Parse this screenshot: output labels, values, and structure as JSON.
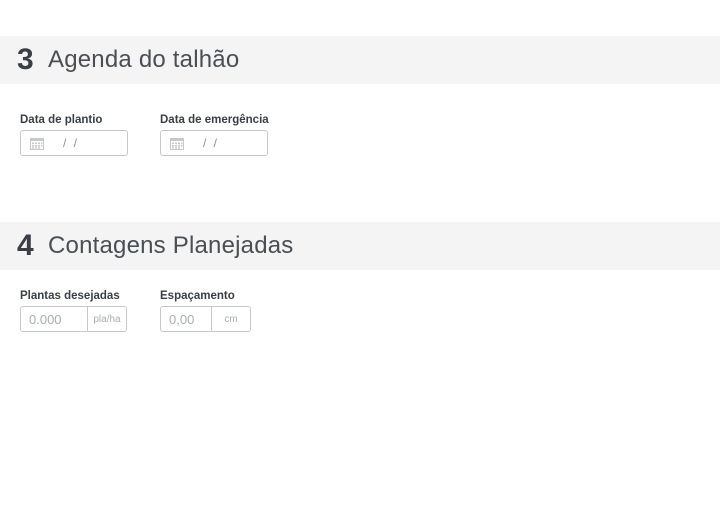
{
  "section3": {
    "number": "3",
    "title": "Agenda do talhão",
    "planting_date": {
      "label": "Data de plantio",
      "mask": "/ /"
    },
    "emergence_date": {
      "label": "Data de emergência",
      "mask": "/ /"
    }
  },
  "section4": {
    "number": "4",
    "title": "Contagens Planejadas",
    "desired_plants": {
      "label": "Plantas desejadas",
      "placeholder": "0.000",
      "unit": "pla/ha"
    },
    "spacing": {
      "label": "Espaçamento",
      "placeholder": "0,00",
      "unit": "cm"
    }
  },
  "icons": {
    "date_field": "calendar-icon"
  },
  "colors": {
    "header_bg": "#f4f4f4",
    "text": "#3a3f45",
    "border": "#c8c8c8",
    "placeholder": "#a8adb2"
  }
}
